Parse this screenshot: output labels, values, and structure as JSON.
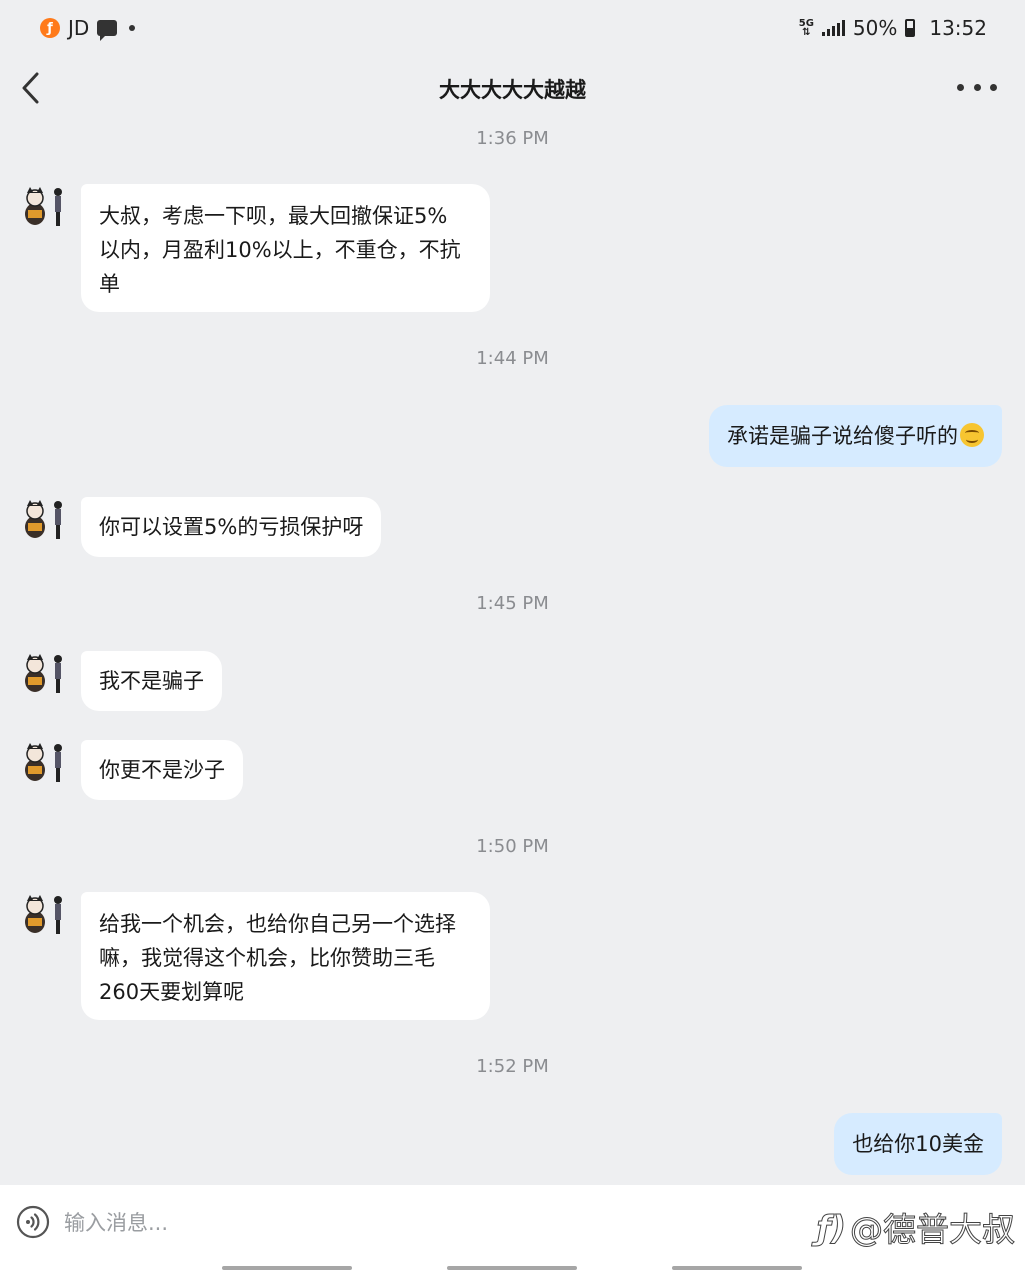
{
  "status_bar": {
    "left_app": "JD",
    "network": "5G",
    "battery": "50%",
    "time": "13:52"
  },
  "header": {
    "title": "大大大大大越越"
  },
  "messages": [
    {
      "type": "timestamp",
      "text": "1:36 PM"
    },
    {
      "type": "in",
      "lines": [
        "大叔，考虑一下呗，最大回撤保证5%",
        "以内，月盈利10%以上，不重仓，不抗",
        "单"
      ]
    },
    {
      "type": "timestamp",
      "text": "1:44 PM"
    },
    {
      "type": "out",
      "text": "承诺是骗子说给傻子听的",
      "emoji": "smiling-face-emoji"
    },
    {
      "type": "in",
      "text": "你可以设置5%的亏损保护呀"
    },
    {
      "type": "timestamp",
      "text": "1:45 PM"
    },
    {
      "type": "in",
      "text": "我不是骗子"
    },
    {
      "type": "in",
      "text": "你更不是沙子"
    },
    {
      "type": "timestamp",
      "text": "1:50 PM"
    },
    {
      "type": "in",
      "lines": [
        "给我一个机会，也给你自己另一个选择",
        "嘛，我觉得这个机会，比你赞助三毛",
        "260天要划算呢"
      ]
    },
    {
      "type": "timestamp",
      "text": "1:52 PM"
    },
    {
      "type": "out",
      "text": "也给你10美金"
    }
  ],
  "input": {
    "placeholder": "输入消息..."
  },
  "watermark": {
    "text": "@德普大叔"
  },
  "colors": {
    "background": "#eeeff1",
    "incoming_bubble": "#ffffff",
    "outgoing_bubble": "#d6ebff",
    "timestamp": "#8a8c90"
  }
}
